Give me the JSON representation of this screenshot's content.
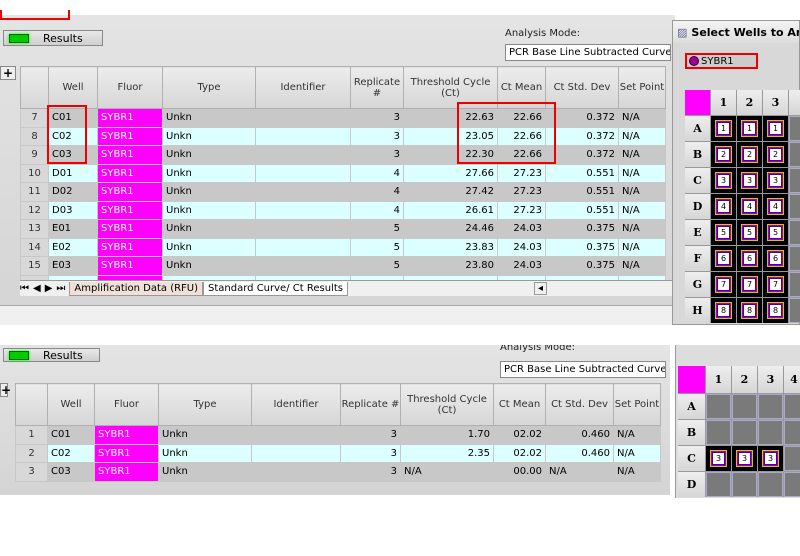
{
  "top": {
    "results_label": "Results",
    "analysis_mode_label": "Analysis Mode:",
    "analysis_mode_value": "PCR Base Line Subtracted Curve Fit",
    "columns": [
      "",
      "Well",
      "Fluor",
      "Type",
      "Identifier",
      "Replicate #",
      "Threshold Cycle (Ct)",
      "Ct Mean",
      "Ct Std. Dev",
      "Set Point"
    ],
    "rows": [
      [
        "7",
        "C01",
        "SYBR1",
        "Unkn",
        "",
        "3",
        "22.63",
        "22.66",
        "0.372",
        "N/A"
      ],
      [
        "8",
        "C02",
        "SYBR1",
        "Unkn",
        "",
        "3",
        "23.05",
        "22.66",
        "0.372",
        "N/A"
      ],
      [
        "9",
        "C03",
        "SYBR1",
        "Unkn",
        "",
        "3",
        "22.30",
        "22.66",
        "0.372",
        "N/A"
      ],
      [
        "10",
        "D01",
        "SYBR1",
        "Unkn",
        "",
        "4",
        "27.66",
        "27.23",
        "0.551",
        "N/A"
      ],
      [
        "11",
        "D02",
        "SYBR1",
        "Unkn",
        "",
        "4",
        "27.42",
        "27.23",
        "0.551",
        "N/A"
      ],
      [
        "12",
        "D03",
        "SYBR1",
        "Unkn",
        "",
        "4",
        "26.61",
        "27.23",
        "0.551",
        "N/A"
      ],
      [
        "13",
        "E01",
        "SYBR1",
        "Unkn",
        "",
        "5",
        "24.46",
        "24.03",
        "0.375",
        "N/A"
      ],
      [
        "14",
        "E02",
        "SYBR1",
        "Unkn",
        "",
        "5",
        "23.83",
        "24.03",
        "0.375",
        "N/A"
      ],
      [
        "15",
        "E03",
        "SYBR1",
        "Unkn",
        "",
        "5",
        "23.80",
        "24.03",
        "0.375",
        "N/A"
      ]
    ],
    "tabs": [
      "Amplification Data (RFU)",
      "Standard Curve/ Ct Results"
    ],
    "plate_title": "Select Wells to Anal",
    "fluor_chip": "SYBR1",
    "plate_cols": [
      "1",
      "2",
      "3"
    ],
    "plate_rows": [
      "A",
      "B",
      "C",
      "D",
      "E",
      "F",
      "G",
      "H"
    ],
    "plate_values": [
      "1",
      "2",
      "3",
      "4",
      "5",
      "6",
      "7",
      "8"
    ]
  },
  "bottom": {
    "results_label": "Results",
    "analysis_mode_label": "Analysis Mode:",
    "analysis_mode_value": "PCR Base Line Subtracted Curve Fit",
    "rows": [
      [
        "1",
        "C01",
        "SYBR1",
        "Unkn",
        "",
        "3",
        "1.70",
        "02.02",
        "0.460",
        "N/A"
      ],
      [
        "2",
        "C02",
        "SYBR1",
        "Unkn",
        "",
        "3",
        "2.35",
        "02.02",
        "0.460",
        "N/A"
      ],
      [
        "3",
        "C03",
        "SYBR1",
        "Unkn",
        "",
        "3",
        "N/A",
        "00.00",
        "N/A",
        "N/A"
      ]
    ],
    "plate_cols": [
      "1",
      "2",
      "3",
      "4"
    ],
    "plate_rows": [
      "A",
      "B",
      "C",
      "D"
    ],
    "plate_value": "3"
  },
  "colors": {
    "fluor": "#ff00ff",
    "highlight": "#e00000",
    "alt_row": "#dcffff"
  }
}
